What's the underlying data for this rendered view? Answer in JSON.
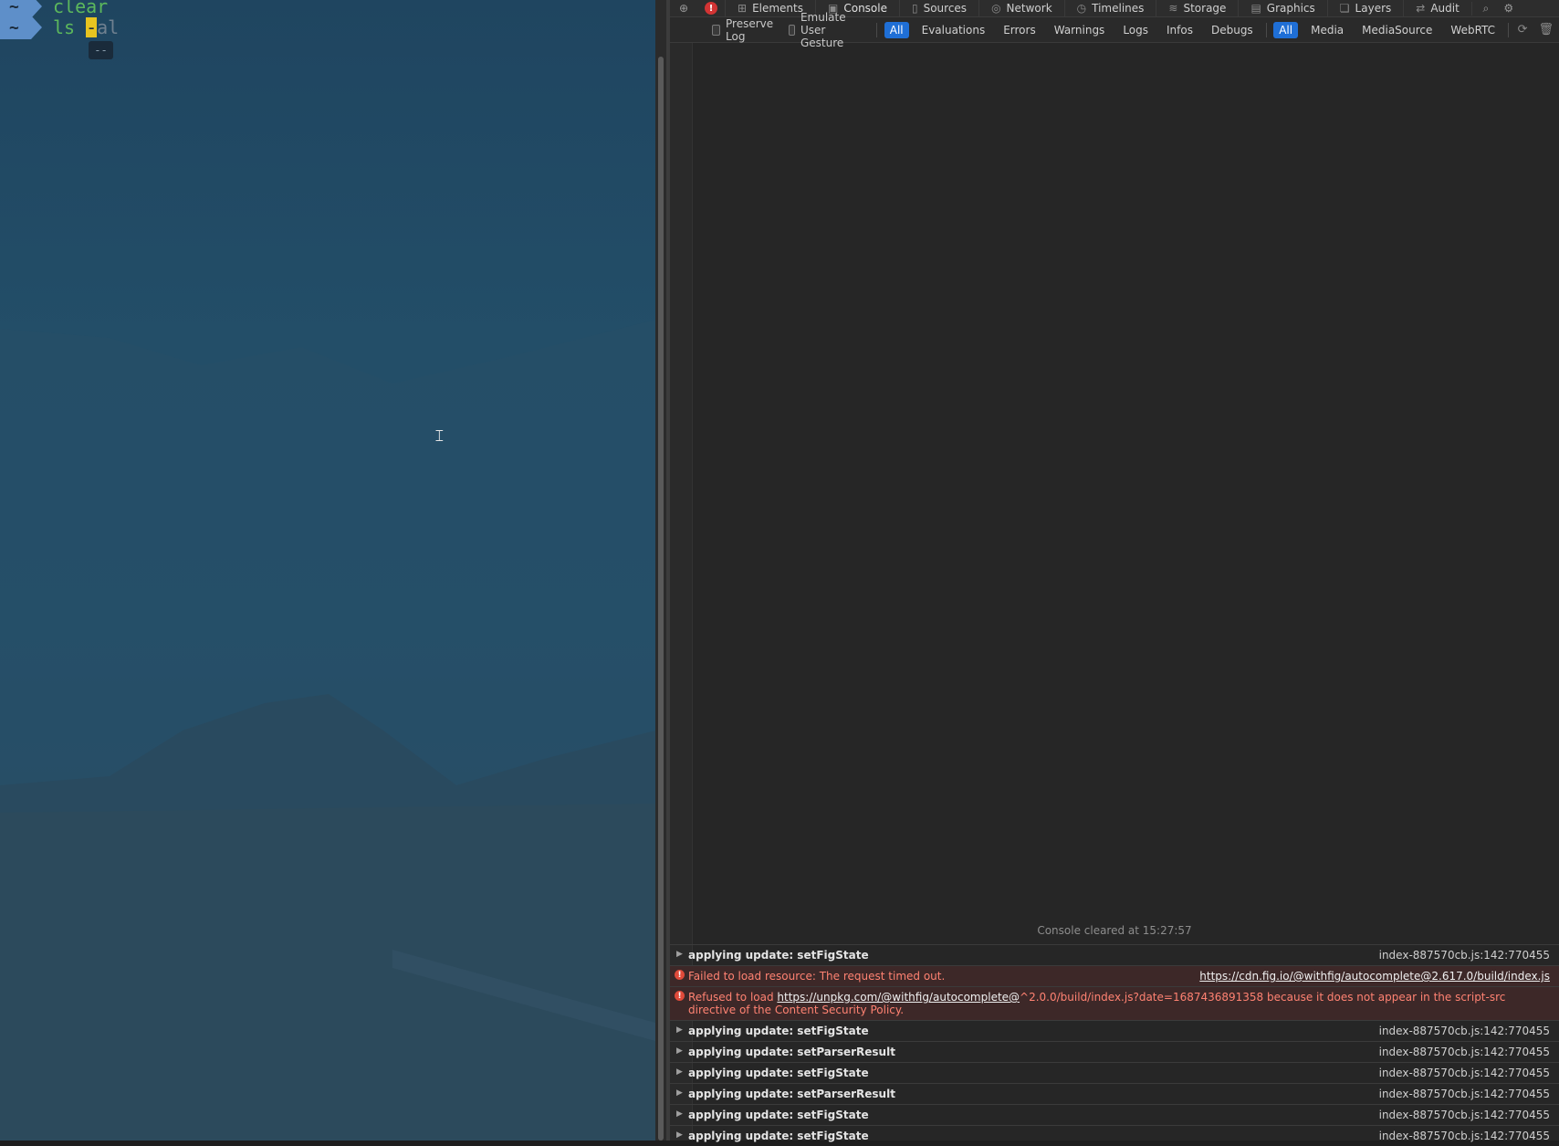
{
  "terminal": {
    "prompt_symbol": "~",
    "lines": [
      {
        "command": "clear"
      },
      {
        "command": "ls ",
        "cursor_char": "-",
        "ghost_text": "al"
      }
    ],
    "autocomplete_hint": "--"
  },
  "devtools": {
    "tabs": [
      {
        "label": "Elements",
        "icon": "elements-icon"
      },
      {
        "label": "Console",
        "icon": "console-icon"
      },
      {
        "label": "Sources",
        "icon": "sources-icon"
      },
      {
        "label": "Network",
        "icon": "network-icon"
      },
      {
        "label": "Timelines",
        "icon": "timelines-icon"
      },
      {
        "label": "Storage",
        "icon": "storage-icon"
      },
      {
        "label": "Graphics",
        "icon": "graphics-icon"
      },
      {
        "label": "Layers",
        "icon": "layers-icon"
      },
      {
        "label": "Audit",
        "icon": "audit-icon"
      }
    ],
    "active_tab": "Console",
    "error_badge": "!",
    "filter": {
      "preserve_log": "Preserve Log",
      "emulate_gesture": "Emulate User Gesture",
      "level_filters": [
        "All",
        "Evaluations",
        "Errors",
        "Warnings",
        "Logs",
        "Infos",
        "Debugs"
      ],
      "source_filters": [
        "All",
        "Media",
        "MediaSource",
        "WebRTC"
      ]
    },
    "console": {
      "cleared_text": "Console cleared at 15:27:57",
      "entries": [
        {
          "type": "log",
          "message": "applying update: setFigState",
          "source": "index-887570cb.js:142:770455"
        },
        {
          "type": "error",
          "message": "Failed to load resource: The request timed out.",
          "source": "https://cdn.fig.io/@withfig/autocomplete@2.617.0/build/index.js"
        },
        {
          "type": "error",
          "message_prefix": "Refused to load ",
          "link": "https://unpkg.com/@withfig/autocomplete@",
          "message_suffix": "^2.0.0/build/index.js?date=1687436891358 because it does not appear in the script-src directive of the Content Security Policy."
        },
        {
          "type": "log",
          "message": "applying update: setFigState",
          "source": "index-887570cb.js:142:770455"
        },
        {
          "type": "log",
          "message": "applying update: setParserResult",
          "source": "index-887570cb.js:142:770455"
        },
        {
          "type": "log",
          "message": "applying update: setFigState",
          "source": "index-887570cb.js:142:770455"
        },
        {
          "type": "log",
          "message": "applying update: setParserResult",
          "source": "index-887570cb.js:142:770455"
        },
        {
          "type": "log",
          "message": "applying update: setFigState",
          "source": "index-887570cb.js:142:770455"
        },
        {
          "type": "log",
          "message": "applying update: setFigState",
          "source": "index-887570cb.js:142:770455"
        }
      ]
    }
  }
}
